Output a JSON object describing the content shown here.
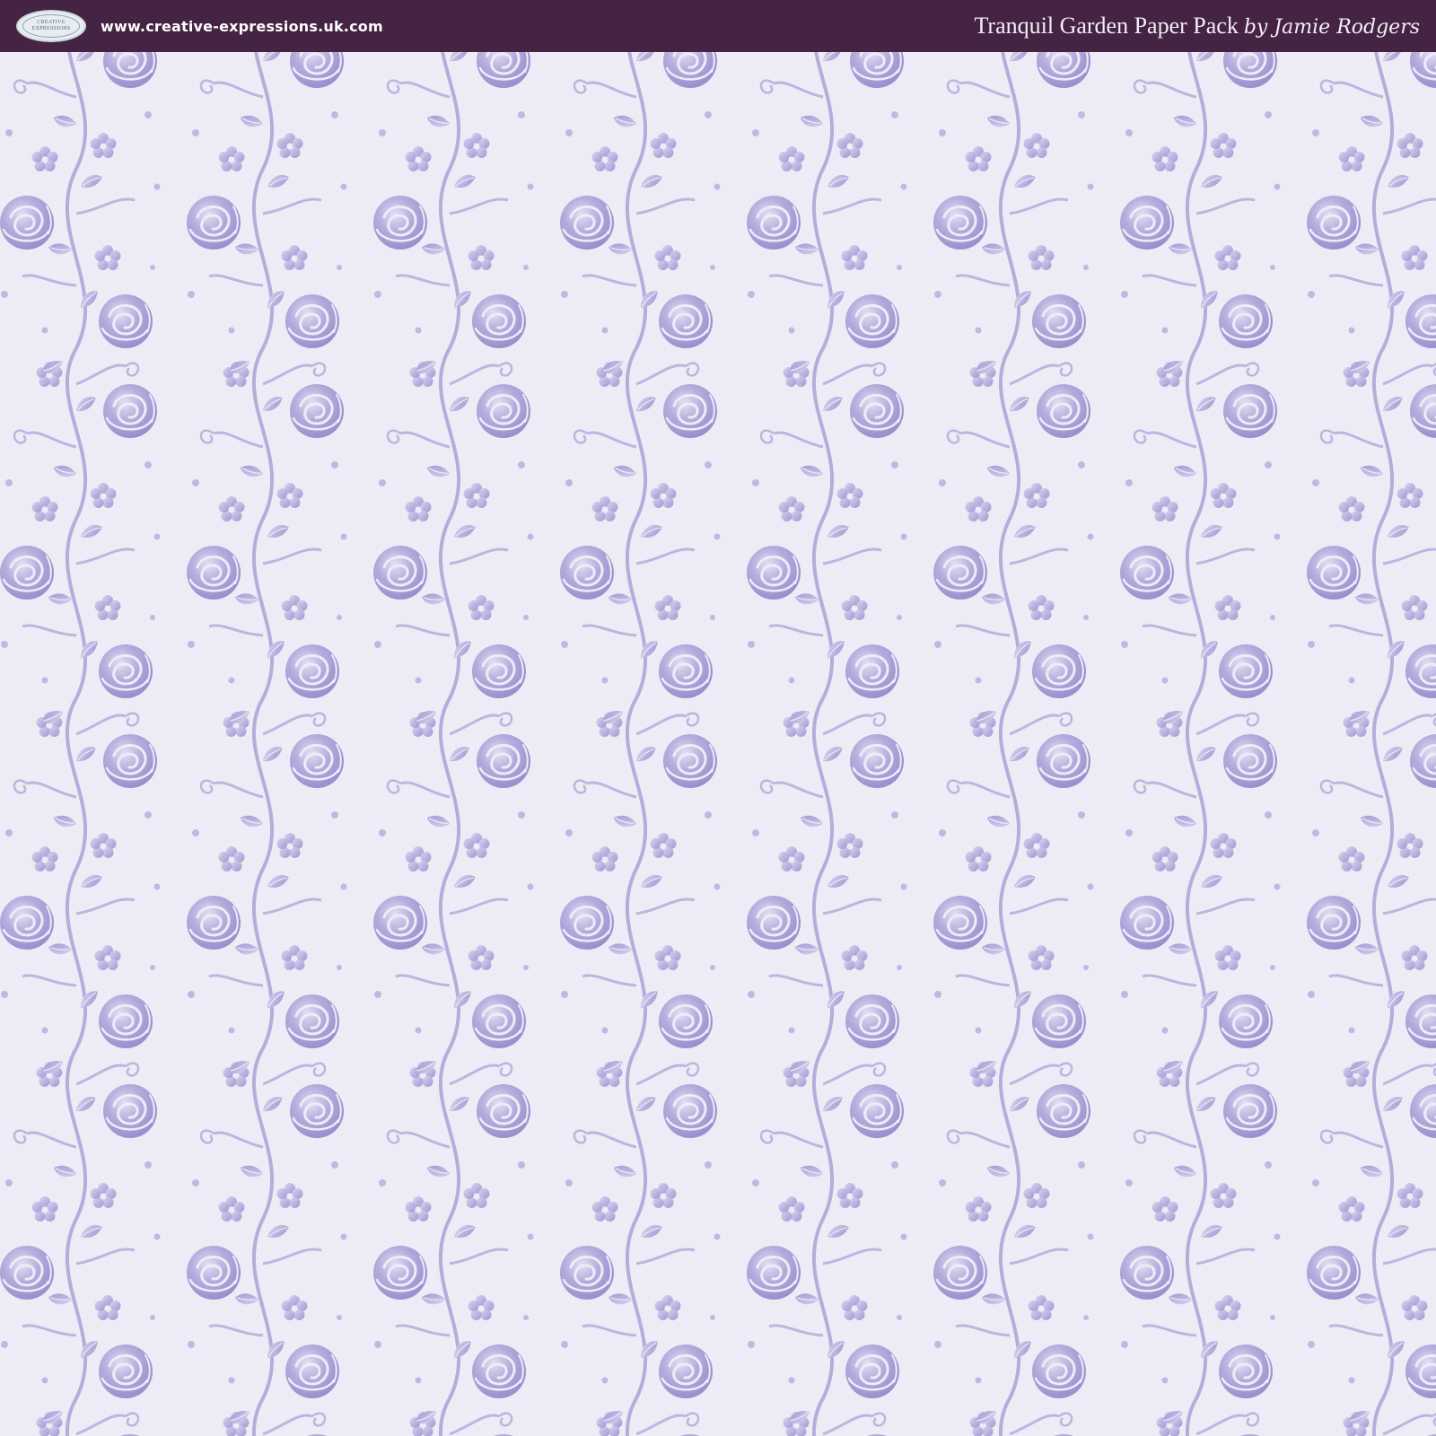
{
  "header": {
    "logo_text_line1": "CREATIVE",
    "logo_text_line2": "EXPRESSIONS",
    "website": "www.creative-expressions.uk.com",
    "title": "Tranquil Garden Paper Pack",
    "author": "by Jamie Rodgers"
  },
  "colors": {
    "header_bg": "#452342",
    "paper_bg": "#f1edf7",
    "floral_primary": "#9b8fcf",
    "floral_light": "#c3b8e6"
  },
  "icons": {
    "logo": "creative-expressions-logo",
    "pattern": "lavender-rose-vine-pattern"
  }
}
